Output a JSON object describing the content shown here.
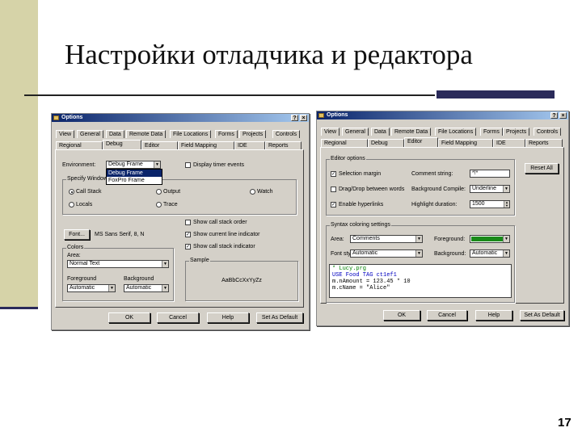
{
  "slide": {
    "title": "Настройки отладчика и редактора",
    "page_number": "17"
  },
  "dialog1": {
    "title": "Options",
    "tabs_row1": [
      "View",
      "General",
      "Data",
      "Remote Data",
      "File Locations",
      "Forms",
      "Projects",
      "Controls"
    ],
    "tabs_row2": [
      "Regional",
      "Debug",
      "Editor",
      "Field Mapping",
      "IDE",
      "Reports"
    ],
    "active_tab": "Debug",
    "environment_label": "Environment:",
    "environment_value": "Debug Frame",
    "environment_options": [
      "Debug Frame",
      "FoxPro Frame"
    ],
    "display_timer_events": "Display timer events",
    "specify_window_label": "Specify Window",
    "windows": [
      "Call Stack",
      "Output",
      "Watch",
      "Locals",
      "Trace"
    ],
    "show_call_stack_order": "Show call stack order",
    "show_current_line": "Show current line indicator",
    "show_call_stack_indicator": "Show call stack indicator",
    "font_button": "Font...",
    "font_value": "MS Sans Serif, 8, N",
    "colors_label": "Colors",
    "area_label": "Area:",
    "area_value": "Normal Text",
    "foreground_label": "Foreground",
    "foreground_value": "Automatic",
    "background_label": "Background",
    "background_value": "Automatic",
    "sample_label": "Sample",
    "sample_text": "AaBbCcXxYyZz",
    "buttons": [
      "OK",
      "Cancel",
      "Help",
      "Set As Default"
    ]
  },
  "dialog2": {
    "title": "Options",
    "tabs_row1": [
      "View",
      "General",
      "Data",
      "Remote Data",
      "File Locations",
      "Forms",
      "Projects",
      "Controls"
    ],
    "tabs_row2": [
      "Regional",
      "Debug",
      "Editor",
      "Field Mapping",
      "IDE",
      "Reports"
    ],
    "active_tab": "Editor",
    "editor_options_label": "Editor options",
    "reset_all": "Reset All",
    "selection_margin": "Selection margin",
    "drag_drop": "Drag/Drop between words",
    "enable_hyperlinks": "Enable hyperlinks",
    "comment_string_label": "Comment string:",
    "comment_string_value": "*!*",
    "background_compile_label": "Background Compile:",
    "background_compile_value": "Underline",
    "highlight_duration_label": "Highlight duration:",
    "highlight_duration_value": "1500",
    "syntax_coloring_label": "Syntax coloring settings",
    "area_label": "Area:",
    "area_value": "Comments",
    "font_style_label": "Font style:",
    "font_style_value": "Automatic",
    "foreground_label": "Foreground:",
    "foreground_color": "#1a8a1a",
    "background_label": "Background:",
    "background_value": "Automatic",
    "code_lines": [
      "* Lucy.prg",
      "USE Food TAG ct1ef1",
      "m.nAmount = 123.45 * 10",
      "m.cName = \"Alice\""
    ],
    "buttons": [
      "OK",
      "Cancel",
      "Help",
      "Set As Default"
    ]
  }
}
